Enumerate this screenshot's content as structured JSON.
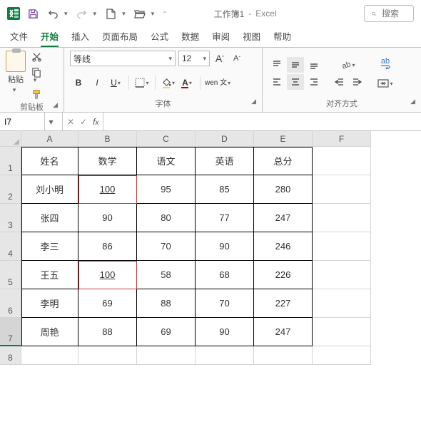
{
  "titlebar": {
    "doc_name": "工作簿1",
    "app_name": "Excel",
    "sep": "-",
    "search_placeholder": "搜索"
  },
  "tabs": {
    "items": [
      "文件",
      "开始",
      "插入",
      "页面布局",
      "公式",
      "数据",
      "审阅",
      "视图",
      "帮助"
    ],
    "active_index": 1
  },
  "ribbon": {
    "clipboard": {
      "label": "剪贴板",
      "paste": "粘贴"
    },
    "font": {
      "label": "字体",
      "name": "等线",
      "size": "12",
      "bold": "B",
      "italic": "I",
      "underline": "U",
      "wen": "wen 文"
    },
    "align": {
      "label": "对齐方式",
      "wrap": "ab"
    }
  },
  "formula_bar": {
    "name_box": "I7",
    "formula": ""
  },
  "sheet": {
    "columns": [
      "A",
      "B",
      "C",
      "D",
      "E",
      "F"
    ],
    "row_numbers": [
      "1",
      "2",
      "3",
      "4",
      "5",
      "6",
      "7",
      "8"
    ],
    "selected_row": 7,
    "headers": [
      "姓名",
      "数学",
      "语文",
      "英语",
      "总分"
    ],
    "rows": [
      {
        "name": "刘小明",
        "math": "100",
        "chinese": "95",
        "english": "85",
        "total": "280",
        "hl": true
      },
      {
        "name": "张四",
        "math": "90",
        "chinese": "80",
        "english": "77",
        "total": "247",
        "hl": false
      },
      {
        "name": "李三",
        "math": "86",
        "chinese": "70",
        "english": "90",
        "total": "246",
        "hl": false
      },
      {
        "name": "王五",
        "math": "100",
        "chinese": "58",
        "english": "68",
        "total": "226",
        "hl": true
      },
      {
        "name": "李明",
        "math": "69",
        "chinese": "88",
        "english": "70",
        "total": "227",
        "hl": false
      },
      {
        "name": "周艳",
        "math": "88",
        "chinese": "69",
        "english": "90",
        "total": "247",
        "hl": false
      }
    ]
  }
}
